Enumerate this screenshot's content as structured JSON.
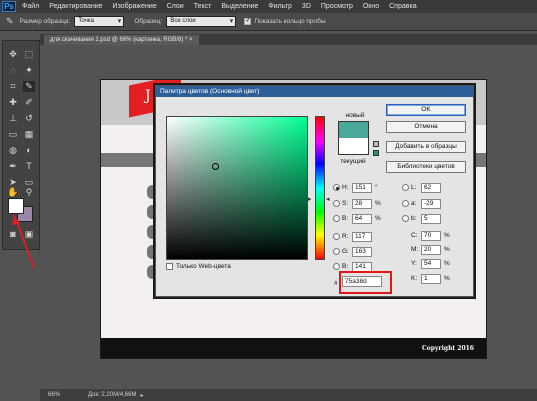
{
  "app": {
    "logo": "Ps",
    "menu": [
      "Файл",
      "Редактирование",
      "Изображение",
      "Слои",
      "Текст",
      "Выделение",
      "Фильтр",
      "3D",
      "Просмотр",
      "Окно",
      "Справка"
    ]
  },
  "options_bar": {
    "sample_size_label": "Размер образца:",
    "sample_size_value": "Точка",
    "sample_label": "Образец:",
    "sample_value": "Все слои",
    "show_ring_label": "Показать кольцо пробы"
  },
  "document": {
    "tab_title": "для скачивания 1.psd @ 66% (картинка, RGB/8) *",
    "header_letter": "J",
    "copyright": "Copyright 2016"
  },
  "status_bar": {
    "zoom": "66%",
    "doc_size": "Док: 2,20M/4,66M"
  },
  "colors": {
    "new_color": "#4aa89a",
    "current_color": "#ffffff",
    "foreground": "#ffffff",
    "background": "#9a86a8",
    "highlight": "#e0161b"
  },
  "picker": {
    "title": "Палитра цветов (Основной цвет)",
    "new_label": "новый",
    "current_label": "текущий",
    "buttons": {
      "ok": "OK",
      "cancel": "Отмена",
      "add_to_swatches": "Добавить в образцы",
      "color_libraries": "Библиотеки цветов"
    },
    "web_only_label": "Только Web-цвета",
    "fields": {
      "H": {
        "label": "H:",
        "value": "151",
        "unit": "°"
      },
      "S": {
        "label": "S:",
        "value": "28",
        "unit": "%"
      },
      "B": {
        "label": "B:",
        "value": "64",
        "unit": "%"
      },
      "R": {
        "label": "R:",
        "value": "117",
        "unit": ""
      },
      "G": {
        "label": "G:",
        "value": "163",
        "unit": ""
      },
      "Bl": {
        "label": "B:",
        "value": "141",
        "unit": ""
      },
      "L": {
        "label": "L:",
        "value": "62",
        "unit": ""
      },
      "a": {
        "label": "a:",
        "value": "-29",
        "unit": ""
      },
      "b": {
        "label": "b:",
        "value": "5",
        "unit": ""
      },
      "C": {
        "label": "C:",
        "value": "70",
        "unit": "%"
      },
      "M": {
        "label": "M:",
        "value": "20",
        "unit": "%"
      },
      "Y": {
        "label": "Y:",
        "value": "54",
        "unit": "%"
      },
      "K": {
        "label": "K:",
        "value": "1",
        "unit": "%"
      }
    },
    "hex_symbol": "#",
    "hex": "75a38d"
  }
}
